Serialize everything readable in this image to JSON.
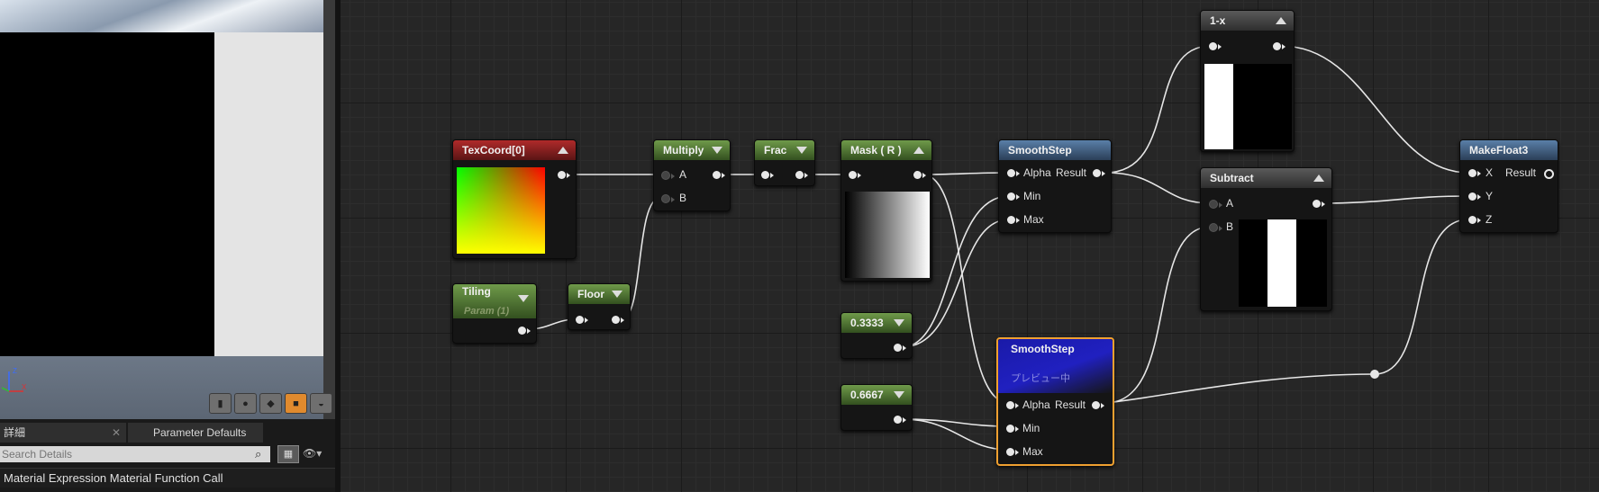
{
  "details_panel": {
    "tabs": [
      {
        "label": "詳細"
      },
      {
        "label": "Parameter Defaults"
      }
    ],
    "search_placeholder": "Search Details",
    "title": "Material Expression Material Function Call"
  },
  "viewport": {
    "buttons": [
      "cylinder",
      "sphere",
      "plane",
      "cube",
      "custom-mesh"
    ],
    "active_button": "cube",
    "axis_labels": {
      "x": "X",
      "z": "Z"
    }
  },
  "graph": {
    "nodes": {
      "texcoord": {
        "title": "TexCoord[0]"
      },
      "tiling": {
        "title": "Tiling",
        "subtitle": "Param (1)"
      },
      "floor": {
        "title": "Floor"
      },
      "multiply": {
        "title": "Multiply",
        "pins": [
          "A",
          "B"
        ]
      },
      "frac": {
        "title": "Frac"
      },
      "mask": {
        "title": "Mask ( R )"
      },
      "const1": {
        "title": "0.3333"
      },
      "const2": {
        "title": "0.6667"
      },
      "smoothstep1": {
        "title": "SmoothStep",
        "pins": [
          "Alpha",
          "Min",
          "Max"
        ],
        "output": "Result"
      },
      "smoothstep2": {
        "title": "SmoothStep",
        "subtitle": "プレビュー中",
        "pins": [
          "Alpha",
          "Min",
          "Max"
        ],
        "output": "Result"
      },
      "oneminus": {
        "title": "1-x"
      },
      "subtract": {
        "title": "Subtract",
        "pins": [
          "A",
          "B"
        ]
      },
      "makefloat3": {
        "title": "MakeFloat3",
        "pins": [
          "X",
          "Y",
          "Z"
        ],
        "output": "Result"
      }
    }
  },
  "colors": {
    "accent_selected": "#f0a030",
    "param_header": "#6f9a4a",
    "texcoord_header": "#b02a2a",
    "function_header": "#5a7fa8",
    "preview_header": "#2a2ab8"
  }
}
